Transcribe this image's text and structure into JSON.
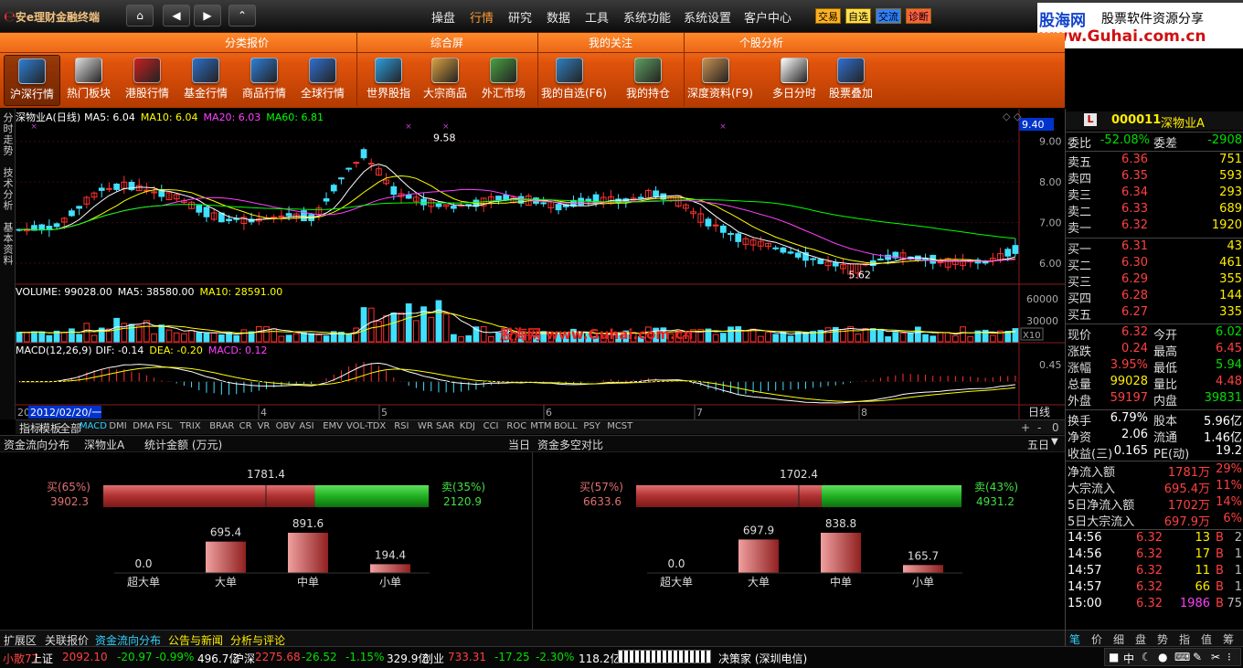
{
  "app": {
    "title": "安e理财金融终端"
  },
  "nav": {
    "home": "⌂",
    "back": "◀",
    "fwd": "▶",
    "up": "⌃"
  },
  "top_menu": [
    "操盘",
    "行情",
    "研究",
    "数据",
    "工具",
    "系统功能",
    "系统设置",
    "客户中心"
  ],
  "tags": [
    {
      "label": "交易",
      "color": "#ffb020"
    },
    {
      "label": "自选",
      "color": "#ffe050"
    },
    {
      "label": "交流",
      "color": "#3080ff"
    },
    {
      "label": "诊断",
      "color": "#ff6040"
    }
  ],
  "brand": {
    "line1": "股海网",
    "line2": "股票软件资源分享",
    "line3": "www.Guhai.com.cn"
  },
  "toolbar": {
    "groups": [
      "分类报价",
      "综合屏",
      "我的关注",
      "个股分析"
    ],
    "buttons": [
      "沪深行情",
      "热门板块",
      "港股行情",
      "基金行情",
      "商品行情",
      "全球行情",
      "世界股指",
      "大宗商品",
      "外汇市场",
      "我的自选(F6)",
      "我的持仓",
      "深度资料(F9)",
      "多日分时",
      "股票叠加"
    ],
    "icons": [
      "quotes-icon",
      "hot-sector-icon",
      "hk-stock-icon",
      "fund-icon",
      "commodity-icon",
      "globe-icon",
      "world-index-icon",
      "bulk-goods-icon",
      "forex-icon",
      "my-watchlist-icon",
      "my-position-icon",
      "depth-data-icon",
      "multi-day-icon",
      "overlay-icon"
    ]
  },
  "left_tabs": [
    "分时走势",
    "技术分析",
    "基本资料"
  ],
  "chart_data": [
    {
      "type": "candlestick",
      "title": "深物业A(日线)",
      "legend": [
        {
          "name": "MA5",
          "value": "6.04",
          "color": "#ffffff"
        },
        {
          "name": "MA10",
          "value": "6.04",
          "color": "#ffff00"
        },
        {
          "name": "MA20",
          "value": "6.03",
          "color": "#ff40ff"
        },
        {
          "name": "MA60",
          "value": "6.81",
          "color": "#00ff00"
        }
      ],
      "y_ticks": [
        "9.00",
        "8.00",
        "7.00",
        "6.00"
      ],
      "ylim": [
        5.5,
        9.4
      ],
      "y_cursor": "9.40",
      "high_label": "9.58",
      "low_label": "5.62"
    },
    {
      "type": "bar",
      "title": "VOLUME",
      "legend": [
        {
          "name": "VOLUME",
          "value": "99028.00",
          "color": "#ffffff"
        },
        {
          "name": "MA5",
          "value": "38580.00",
          "color": "#ffffff"
        },
        {
          "name": "MA10",
          "value": "28591.00",
          "color": "#ffff00"
        }
      ],
      "y_ticks": [
        "60000",
        "30000"
      ],
      "unit": "X10"
    },
    {
      "type": "line",
      "title": "MACD(12,26,9)",
      "legend": [
        {
          "name": "DIF",
          "value": "-0.14",
          "color": "#ffffff"
        },
        {
          "name": "DEA",
          "value": "-0.20",
          "color": "#ffff00"
        },
        {
          "name": "MACD",
          "value": "0.12",
          "color": "#ff40ff"
        }
      ],
      "y_ticks": [
        "0.45"
      ]
    }
  ],
  "watermark": "股海网 www.Guhai.com.cn",
  "x_axis": {
    "start": "20",
    "date": "2012/02/20/一",
    "months": [
      "4",
      "5",
      "6",
      "7",
      "8"
    ],
    "period": "日线"
  },
  "indicator_tabs": [
    "指标",
    "模板",
    "全部",
    "MACD",
    "DMI",
    "DMA",
    "FSL",
    "TRIX",
    "BRAR",
    "CR",
    "VR",
    "OBV",
    "ASI",
    "EMV",
    "VOL-TDX",
    "RSI",
    "WR",
    "SAR",
    "KDJ",
    "CCI",
    "ROC",
    "MTM",
    "BOLL",
    "PSY",
    "MCST"
  ],
  "zoom": {
    "plus": "+",
    "minus": "-",
    "zero": "0"
  },
  "stock": {
    "code": "000011",
    "name": "深物业A",
    "badge": "L"
  },
  "ratio": {
    "wb_label": "委比",
    "wb": "-52.08%",
    "wc_label": "委差",
    "wc": "-2908"
  },
  "asks": [
    {
      "label": "卖五",
      "price": "6.36",
      "vol": "751"
    },
    {
      "label": "卖四",
      "price": "6.35",
      "vol": "593"
    },
    {
      "label": "卖三",
      "price": "6.34",
      "vol": "293"
    },
    {
      "label": "卖二",
      "price": "6.33",
      "vol": "689"
    },
    {
      "label": "卖一",
      "price": "6.32",
      "vol": "1920"
    }
  ],
  "bids": [
    {
      "label": "买一",
      "price": "6.31",
      "vol": "43"
    },
    {
      "label": "买二",
      "price": "6.30",
      "vol": "461"
    },
    {
      "label": "买三",
      "price": "6.29",
      "vol": "355"
    },
    {
      "label": "买四",
      "price": "6.28",
      "vol": "144"
    },
    {
      "label": "买五",
      "price": "6.27",
      "vol": "335"
    }
  ],
  "quote": [
    {
      "l1": "现价",
      "v1": "6.32",
      "c1": "#ff4040",
      "l2": "今开",
      "v2": "6.02",
      "c2": "#00e000"
    },
    {
      "l1": "涨跌",
      "v1": "0.24",
      "c1": "#ff4040",
      "l2": "最高",
      "v2": "6.45",
      "c2": "#ff4040"
    },
    {
      "l1": "涨幅",
      "v1": "3.95%",
      "c1": "#ff4040",
      "l2": "最低",
      "v2": "5.94",
      "c2": "#00e000"
    },
    {
      "l1": "总量",
      "v1": "99028",
      "c1": "#ffee00",
      "l2": "量比",
      "v2": "4.48",
      "c2": "#ff4040"
    },
    {
      "l1": "外盘",
      "v1": "59197",
      "c1": "#ff4040",
      "l2": "内盘",
      "v2": "39831",
      "c2": "#00e000"
    }
  ],
  "stats": [
    {
      "l1": "换手",
      "v1": "6.79%",
      "l2": "股本",
      "v2": "5.96亿"
    },
    {
      "l1": "净资",
      "v1": "2.06",
      "l2": "流通",
      "v2": "1.46亿"
    },
    {
      "l1": "收益(三)",
      "v1": "0.165",
      "l2": "PE(动)",
      "v2": "19.2"
    }
  ],
  "flows": [
    {
      "label": "净流入额",
      "value": "1781万",
      "pct": "29%"
    },
    {
      "label": "大宗流入",
      "value": "695.4万",
      "pct": "11%"
    },
    {
      "label": "5日净流入额",
      "value": "1702万",
      "pct": "14%"
    },
    {
      "label": "5日大宗流入",
      "value": "697.9万",
      "pct": "6%"
    }
  ],
  "ticks": [
    {
      "time": "14:56",
      "price": "6.32",
      "vol": "13",
      "side": "B",
      "n": "2"
    },
    {
      "time": "14:56",
      "price": "6.32",
      "vol": "17",
      "side": "B",
      "n": "1"
    },
    {
      "time": "14:57",
      "price": "6.32",
      "vol": "11",
      "side": "B",
      "n": "1"
    },
    {
      "time": "14:57",
      "price": "6.32",
      "vol": "66",
      "side": "B",
      "n": "1"
    },
    {
      "time": "15:00",
      "price": "6.32",
      "vol": "1986",
      "side": "B",
      "n": "75"
    }
  ],
  "right_tabs": [
    "笔",
    "价",
    "细",
    "盘",
    "势",
    "指",
    "值",
    "筹"
  ],
  "flow_panel": {
    "title": "资金流向分布",
    "stock": "深物业A",
    "metric": "统计金额 (万元)",
    "period": "当日",
    "net": "1781.4",
    "buy_label": "买(65%)",
    "buy": "3902.3",
    "sell_label": "卖(35%)",
    "sell": "2120.9",
    "buy_frac": 0.65,
    "bars": [
      {
        "name": "超大单",
        "value": 0.0,
        "label": "0.0"
      },
      {
        "name": "大单",
        "value": 695.4,
        "label": "695.4"
      },
      {
        "name": "中单",
        "value": 891.6,
        "label": "891.6"
      },
      {
        "name": "小单",
        "value": 194.4,
        "label": "194.4"
      }
    ]
  },
  "cmp_panel": {
    "title": "资金多空对比",
    "period": "五日",
    "net": "1702.4",
    "buy_label": "买(57%)",
    "buy": "6633.6",
    "sell_label": "卖(43%)",
    "sell": "4931.2",
    "buy_frac": 0.57,
    "bars": [
      {
        "name": "超大单",
        "value": 0.0,
        "label": "0.0"
      },
      {
        "name": "大单",
        "value": 697.9,
        "label": "697.9"
      },
      {
        "name": "中单",
        "value": 838.8,
        "label": "838.8"
      },
      {
        "name": "小单",
        "value": 165.7,
        "label": "165.7"
      }
    ]
  },
  "bottom_tabs": [
    "扩展区",
    "关联报价",
    "资金流向分布",
    "公告与新闻",
    "分析与评论"
  ],
  "status": {
    "user": "小散77",
    "sh": {
      "label": "上证",
      "price": "2092.10",
      "chg": "-20.97",
      "pct": "-0.99%",
      "amt": "496.7亿"
    },
    "hs": {
      "label": "沪深",
      "price": "2275.68",
      "chg": "-26.52",
      "pct": "-1.15%",
      "amt": "329.9亿"
    },
    "cy": {
      "label": "创业",
      "price": "733.31",
      "chg": "-17.25",
      "pct": "-2.30%",
      "amt": "118.2亿"
    },
    "broker": "决策家 (深圳电信)",
    "lang": "中"
  }
}
